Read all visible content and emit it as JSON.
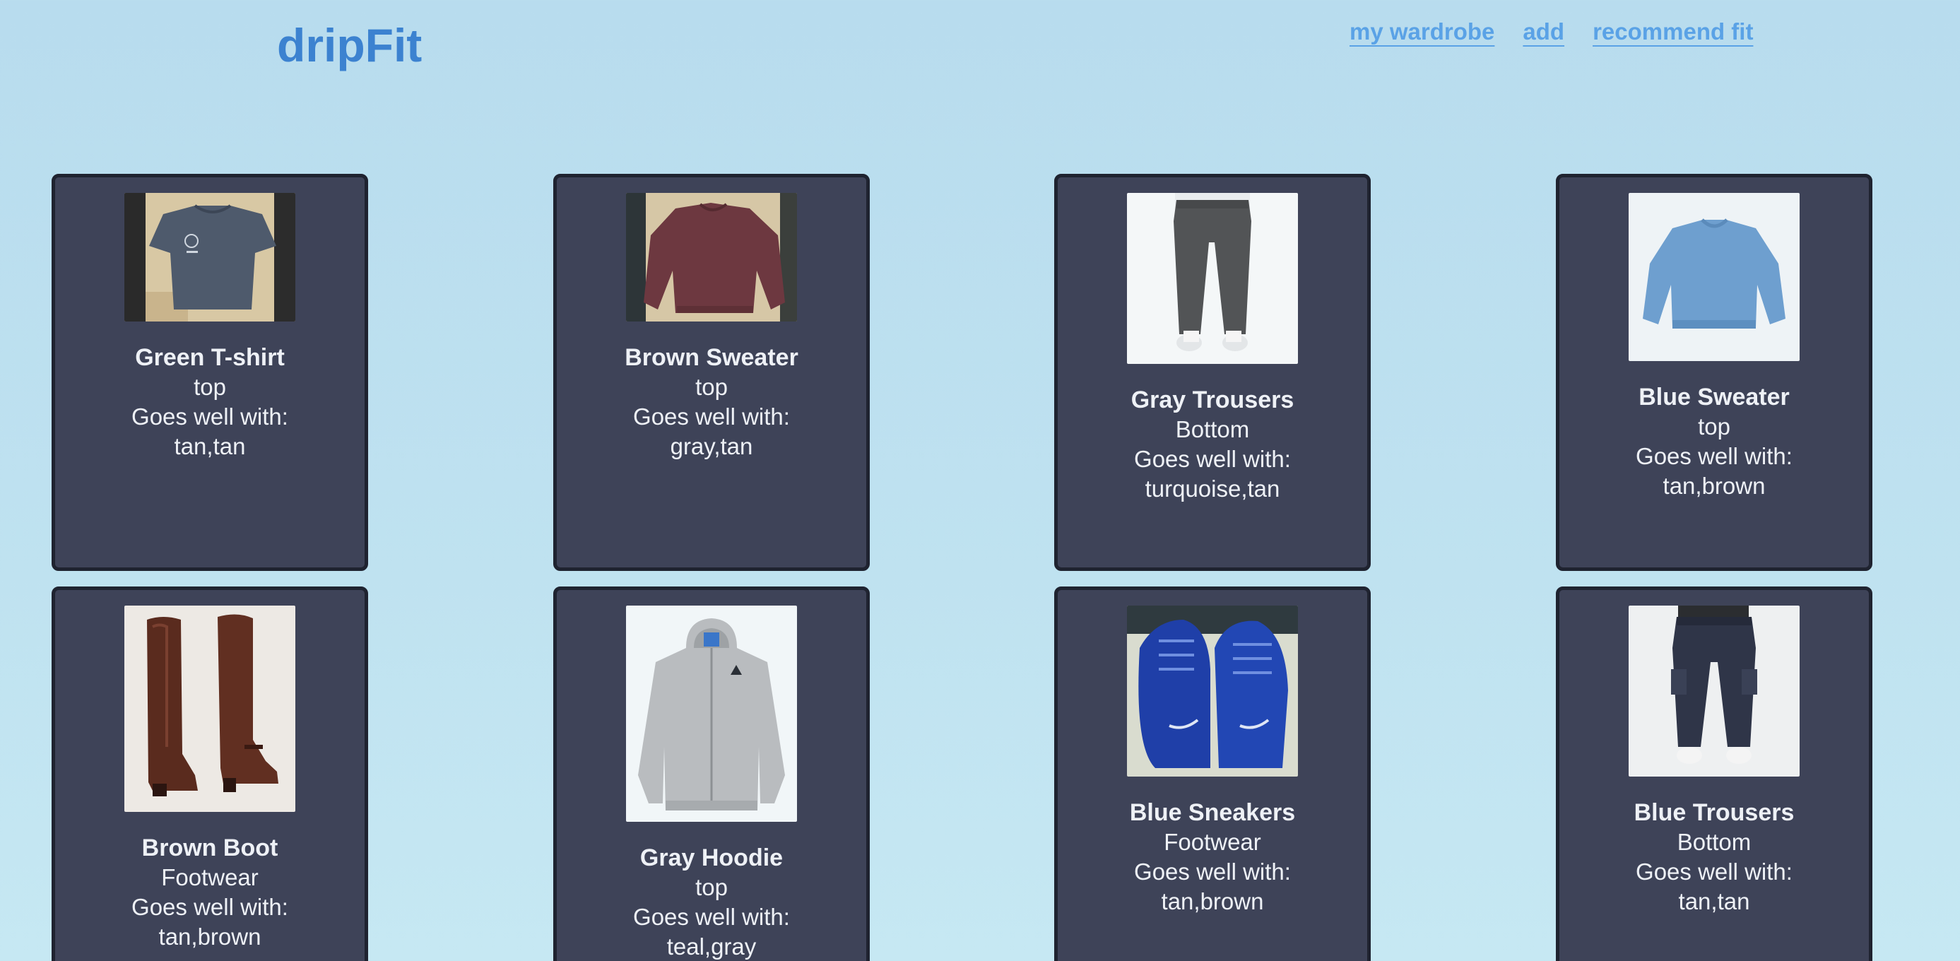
{
  "header": {
    "logo": "dripFit",
    "nav": [
      {
        "label": "my wardrobe"
      },
      {
        "label": "add"
      },
      {
        "label": "recommend fit"
      }
    ]
  },
  "wardrobe": {
    "goes_well_label": "Goes well with:",
    "items": [
      {
        "name": "Green T-shirt",
        "category": "top",
        "colors": "tan,tan",
        "image": "t-shirt-photo"
      },
      {
        "name": "Brown Sweater",
        "category": "top",
        "colors": "gray,tan",
        "image": "sweater-photo"
      },
      {
        "name": "Gray Trousers",
        "category": "Bottom",
        "colors": "turquoise,tan",
        "image": "trousers-photo"
      },
      {
        "name": "Blue Sweater",
        "category": "top",
        "colors": "tan,brown",
        "image": "sweater-photo"
      },
      {
        "name": "Brown Boot",
        "category": "Footwear",
        "colors": "tan,brown",
        "image": "boots-photo"
      },
      {
        "name": "Gray Hoodie",
        "category": "top",
        "colors": "teal,gray",
        "image": "hoodie-photo"
      },
      {
        "name": "Blue Sneakers",
        "category": "Footwear",
        "colors": "tan,brown",
        "image": "sneakers-photo"
      },
      {
        "name": "Blue Trousers",
        "category": "Bottom",
        "colors": "tan,tan",
        "image": "trousers-photo"
      }
    ]
  },
  "colors": {
    "background": "#bfe2f0",
    "card": "#3e4358",
    "card_border": "#1f2330",
    "logo": "#3c82d0",
    "nav_link": "#5aa2e6"
  }
}
